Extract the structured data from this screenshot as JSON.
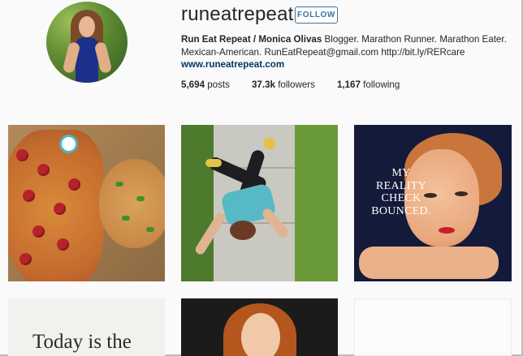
{
  "profile": {
    "username": "runeatrepeat",
    "follow_label": "FOLLOW",
    "bio_name": "Run Eat Repeat / Monica Olivas",
    "bio_text": " Blogger. Marathon Runner. Marathon Eater. Mexican-American. RunEatRepeat@gmail.com http://bit.ly/RERcare",
    "website": "www.runeatrepeat.com",
    "stats": {
      "posts_count": "5,694",
      "posts_label": " posts",
      "followers_count": "37.3k",
      "followers_label": " followers",
      "following_count": "1,167",
      "following_label": " following"
    }
  },
  "grid": {
    "vintage_caption": "MY REALITY CHECK BOUNCED.",
    "quote_text": "Today is the"
  },
  "colors": {
    "accent": "#3f729b",
    "link": "#003569",
    "background": "#fafafa"
  }
}
